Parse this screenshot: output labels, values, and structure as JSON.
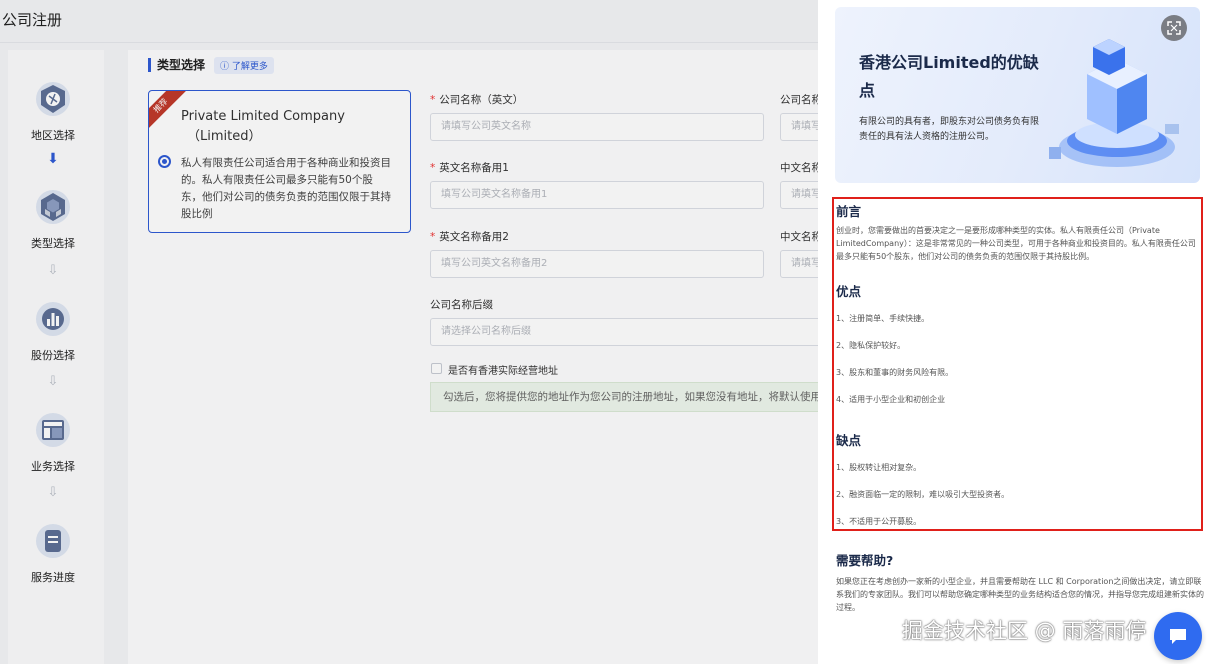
{
  "page": {
    "title": "公司注册"
  },
  "steps": [
    {
      "label": "地区选择",
      "icon": "globe-icon"
    },
    {
      "label": "类型选择",
      "icon": "cubes-icon"
    },
    {
      "label": "股份选择",
      "icon": "bar-chart-icon"
    },
    {
      "label": "业务选择",
      "icon": "layout-icon"
    },
    {
      "label": "服务进度",
      "icon": "document-icon"
    }
  ],
  "type_section": {
    "title": "类型选择",
    "learn_more": "了解更多",
    "card": {
      "badge": "推荐",
      "name": "Private Limited Company",
      "name_sub": "（Limited）",
      "description": "私人有限责任公司适合用于各种商业和投资目的。私人有限责任公司最多只能有50个股东，他们对公司的债务负责的范围仅限于其持股比例"
    }
  },
  "form": {
    "name_en_label": "公司名称（英文）",
    "name_en_placeholder": "请填写公司英文名称",
    "name_cn_label_partial": "公司名称",
    "name_cn_placeholder_partial": "请填写",
    "alt1_label": "英文名称备用1",
    "alt1_placeholder": "填写公司英文名称备用1",
    "alt1_cn_label_partial": "中文名称",
    "alt1_cn_placeholder_partial": "请填写",
    "alt2_label": "英文名称备用2",
    "alt2_placeholder": "填写公司英文名称备用2",
    "alt2_cn_label_partial": "中文名称",
    "alt2_cn_placeholder_partial": "请填写",
    "suffix_label": "公司名称后缀",
    "suffix_placeholder": "请选择公司名称后缀",
    "hk_address_label": "是否有香港实际经营地址",
    "notice": "勾选后，您将提供您的地址作为您公司的注册地址，如果您没有地址，将默认使用"
  },
  "drawer": {
    "banner": {
      "title": "香港公司Limited的优缺点",
      "desc": "有限公司的具有者，即股东对公司债务负有限责任的具有法人资格的注册公司。"
    },
    "preface": {
      "heading": "前言",
      "text": "创业时，您需要做出的首要决定之一是要形成哪种类型的实体。私人有限责任公司（Private LimitedCompany）：这是非常常见的一种公司类型，可用于各种商业和投资目的。私人有限责任公司最多只能有50个股东，他们对公司的债务负责的范围仅限于其持股比例。"
    },
    "pros": {
      "heading": "优点",
      "items": [
        "1、注册简单、手续快捷。",
        "2、隐私保护较好。",
        "3、股东和董事的财务风险有限。",
        "4、适用于小型企业和初创企业"
      ]
    },
    "cons": {
      "heading": "缺点",
      "items": [
        "1、股权转让相对复杂。",
        "2、融资面临一定的限制，难以吸引大型投资者。",
        "3、不适用于公开募股。"
      ]
    },
    "help": {
      "heading": "需要帮助?",
      "text": "如果您正在考虑创办一家新的小型企业，并且需要帮助在 LLC 和 Corporation之间做出决定，请立即联系我们的专家团队。我们可以帮助您确定哪种类型的业务结构适合您的情况，并指导您完成组建新实体的过程。"
    }
  },
  "watermark": "掘金技术社区 @ 雨落雨停",
  "colors": {
    "primary": "#2f5bd6",
    "highlight": "#e0201a",
    "heading": "#1b2a4a"
  }
}
